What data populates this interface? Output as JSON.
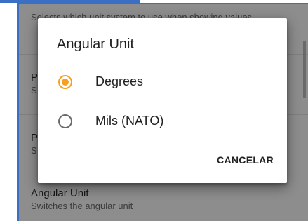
{
  "settings": {
    "items": [
      {
        "title": "",
        "summary": "Selects which unit system to use when showing values"
      },
      {
        "title": "P",
        "summary": "S"
      },
      {
        "title": "P",
        "summary": "S"
      },
      {
        "title": "Angular Unit",
        "summary": "Switches the angular unit"
      }
    ]
  },
  "dialog": {
    "title": "Angular Unit",
    "options": [
      {
        "label": "Degrees",
        "selected": true
      },
      {
        "label": "Mils (NATO)",
        "selected": false
      }
    ],
    "cancel_label": "CANCELAR"
  },
  "colors": {
    "accent": "#f5a020",
    "frame_border": "#3a6fc4",
    "scrim": "#8d8d8d"
  }
}
